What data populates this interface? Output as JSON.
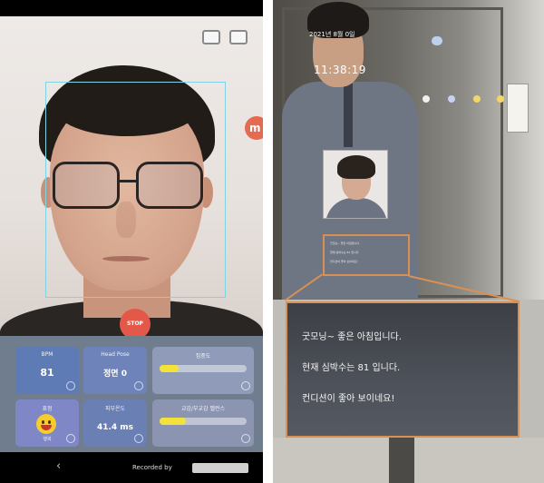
{
  "left_app": {
    "status_text": "",
    "stop_label": "STOP",
    "edge_label": "m",
    "tiles": [
      {
        "title": "BPM",
        "value": "81"
      },
      {
        "title": "Head Pose",
        "value": "정면 0"
      },
      {
        "title": "집중도",
        "bar_fill": 0.22,
        "ticks": [
          "",
          "",
          ""
        ]
      },
      {
        "title": "표정",
        "value": "행복",
        "icon": "happy-face-icon"
      },
      {
        "title": "피부온도",
        "value": "41.4 ms"
      },
      {
        "title": "교감/부교감 밸런스",
        "bar_fill": 0.3,
        "ticks": [
          "",
          ""
        ]
      }
    ],
    "nav": {
      "back_icon": "back-chevron-icon",
      "recorded_by": "Recorded by",
      "recorder_logo": "recorder-logo"
    }
  },
  "right_mirror": {
    "date": "2021년 8월 0일",
    "time": "11:38:19",
    "weather_icons": [
      "cloud-icon",
      "sun-icon",
      "sun-icon",
      "sun-icon",
      "sun-icon"
    ],
    "message_lines": [
      "굿모닝~ 좋은 아침입니다.",
      "현재 심박수는 81 입니다.",
      "컨디션이 좋아 보이네요!"
    ]
  },
  "colors": {
    "facebox": "#7fd3e4",
    "stop_button": "#e35848",
    "callout": "#d99055",
    "bar_fill": "#f2e23a"
  }
}
